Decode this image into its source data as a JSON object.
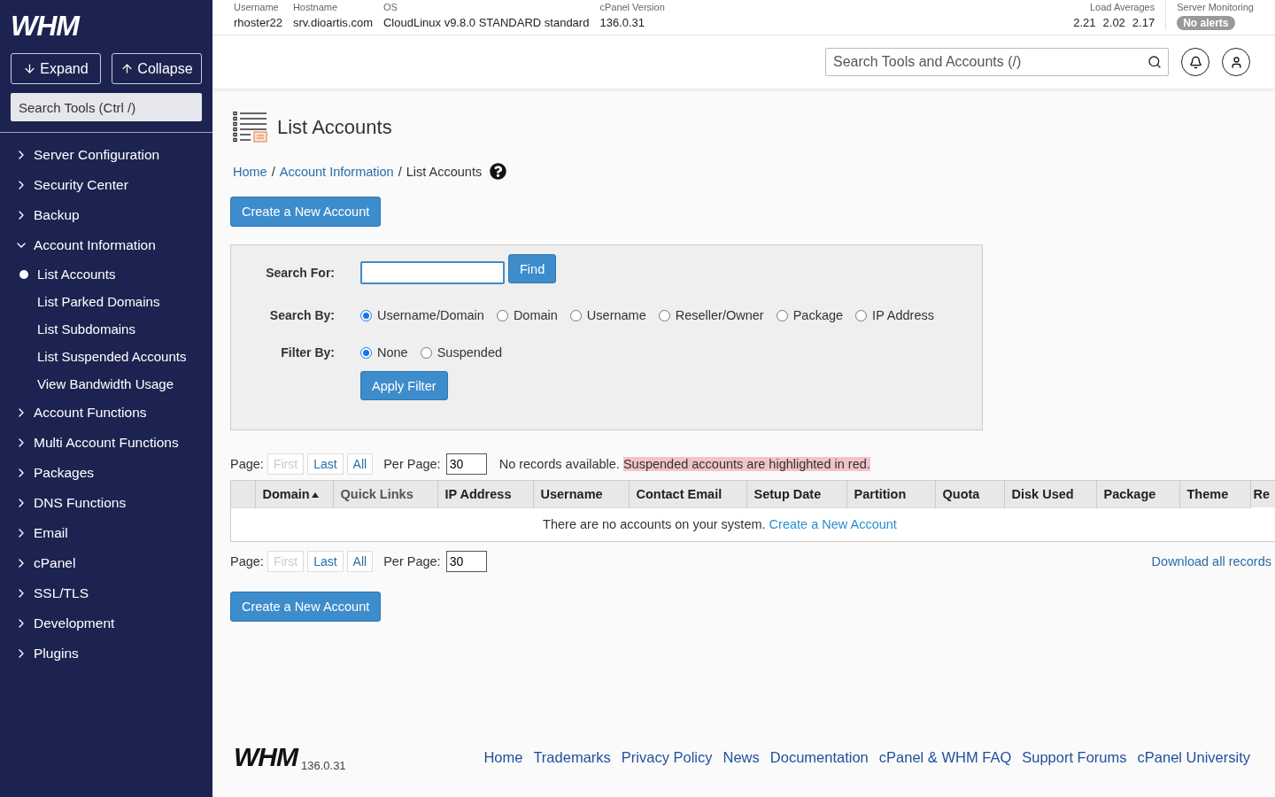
{
  "sidebar": {
    "logo": "WHM",
    "expand_button": "Expand",
    "collapse_button": "Collapse",
    "search": {
      "placeholder": "Search Tools (Ctrl /)"
    },
    "items": [
      {
        "label": "Server Configuration",
        "expanded": false
      },
      {
        "label": "Security Center",
        "expanded": false
      },
      {
        "label": "Backup",
        "expanded": false
      },
      {
        "label": "Account Information",
        "expanded": true,
        "children": [
          {
            "label": "List Accounts",
            "selected": true
          },
          {
            "label": "List Parked Domains",
            "selected": false
          },
          {
            "label": "List Subdomains",
            "selected": false
          },
          {
            "label": "List Suspended Accounts",
            "selected": false
          },
          {
            "label": "View Bandwidth Usage",
            "selected": false
          }
        ]
      },
      {
        "label": "Account Functions",
        "expanded": false
      },
      {
        "label": "Multi Account Functions",
        "expanded": false
      },
      {
        "label": "Packages",
        "expanded": false
      },
      {
        "label": "DNS Functions",
        "expanded": false
      },
      {
        "label": "Email",
        "expanded": false
      },
      {
        "label": "cPanel",
        "expanded": false
      },
      {
        "label": "SSL/TLS",
        "expanded": false
      },
      {
        "label": "Development",
        "expanded": false
      },
      {
        "label": "Plugins",
        "expanded": false
      }
    ]
  },
  "server_info": [
    {
      "label": "Username",
      "value": "rhoster22"
    },
    {
      "label": "Hostname",
      "value": "srv.dioartis.com"
    },
    {
      "label": "OS",
      "value": "CloudLinux v9.8.0 STANDARD standard"
    },
    {
      "label": "cPanel Version",
      "value": "136.0.31"
    }
  ],
  "load_averages": {
    "label": "Load Averages",
    "values": [
      "2.21",
      "2.02",
      "2.17"
    ]
  },
  "server_monitoring": {
    "label": "Server Monitoring",
    "badge": "No alerts"
  },
  "header_search": {
    "placeholder": "Search Tools and Accounts (/)"
  },
  "page": {
    "title": "List Accounts",
    "breadcrumb": [
      {
        "label": "Home",
        "link": true,
        "separator": "/"
      },
      {
        "label": "Account Information",
        "link": true,
        "separator": "/"
      },
      {
        "label": "List Accounts",
        "link": false
      }
    ],
    "create_button": "Create a New Account"
  },
  "search_panel": {
    "search_for_label": "Search For:",
    "find_button": "Find",
    "search_by_label": "Search By:",
    "search_by": [
      {
        "label": "Username/Domain",
        "selected": true
      },
      {
        "label": "Domain",
        "selected": false
      },
      {
        "label": "Username",
        "selected": false
      },
      {
        "label": "Reseller/Owner",
        "selected": false
      },
      {
        "label": "Package",
        "selected": false
      },
      {
        "label": "IP Address",
        "selected": false
      }
    ],
    "filter_by_label": "Filter By:",
    "filter_by": [
      {
        "label": "None",
        "selected": true
      },
      {
        "label": "Suspended",
        "selected": false
      }
    ],
    "apply_button": "Apply Filter"
  },
  "pagination_top": {
    "label": "Page:",
    "buttons": [
      {
        "label": "First",
        "disabled": true
      },
      {
        "label": "Last",
        "disabled": false
      },
      {
        "label": "All",
        "disabled": false
      }
    ],
    "per_page_label": "Per Page:",
    "per_page": "30",
    "notice": "No records available.",
    "highlight_notice": "Suspended accounts are highlighted in red."
  },
  "table": {
    "columns": [
      {
        "label": "Domain",
        "sortable": true,
        "sorted": true
      },
      {
        "label": "Quick Links",
        "sortable": false,
        "sorted": false
      },
      {
        "label": "IP Address",
        "sortable": true,
        "sorted": false
      },
      {
        "label": "Username",
        "sortable": true,
        "sorted": false
      },
      {
        "label": "Contact Email",
        "sortable": true,
        "sorted": false
      },
      {
        "label": "Setup Date",
        "sortable": true,
        "sorted": false
      },
      {
        "label": "Partition",
        "sortable": true,
        "sorted": false
      },
      {
        "label": "Quota",
        "sortable": true,
        "sorted": false
      },
      {
        "label": "Disk Used",
        "sortable": true,
        "sorted": false
      },
      {
        "label": "Package",
        "sortable": true,
        "sorted": false
      },
      {
        "label": "Theme",
        "sortable": true,
        "sorted": false
      },
      {
        "label": "Re",
        "sortable": true,
        "sorted": false
      }
    ],
    "empty_message": "There are no accounts on your system.",
    "empty_link": "Create a New Account"
  },
  "pagination_bottom": {
    "label": "Page:",
    "buttons": [
      {
        "label": "First",
        "disabled": true
      },
      {
        "label": "Last",
        "disabled": false
      },
      {
        "label": "All",
        "disabled": false
      }
    ],
    "per_page_label": "Per Page:",
    "per_page": "30",
    "download_link": "Download all records"
  },
  "bottom_create_button": "Create a New Account",
  "footer": {
    "logo": "WHM",
    "version": "136.0.31",
    "links": [
      "Home",
      "Trademarks",
      "Privacy Policy",
      "News",
      "Documentation",
      "cPanel & WHM FAQ",
      "Support Forums",
      "cPanel University"
    ]
  }
}
